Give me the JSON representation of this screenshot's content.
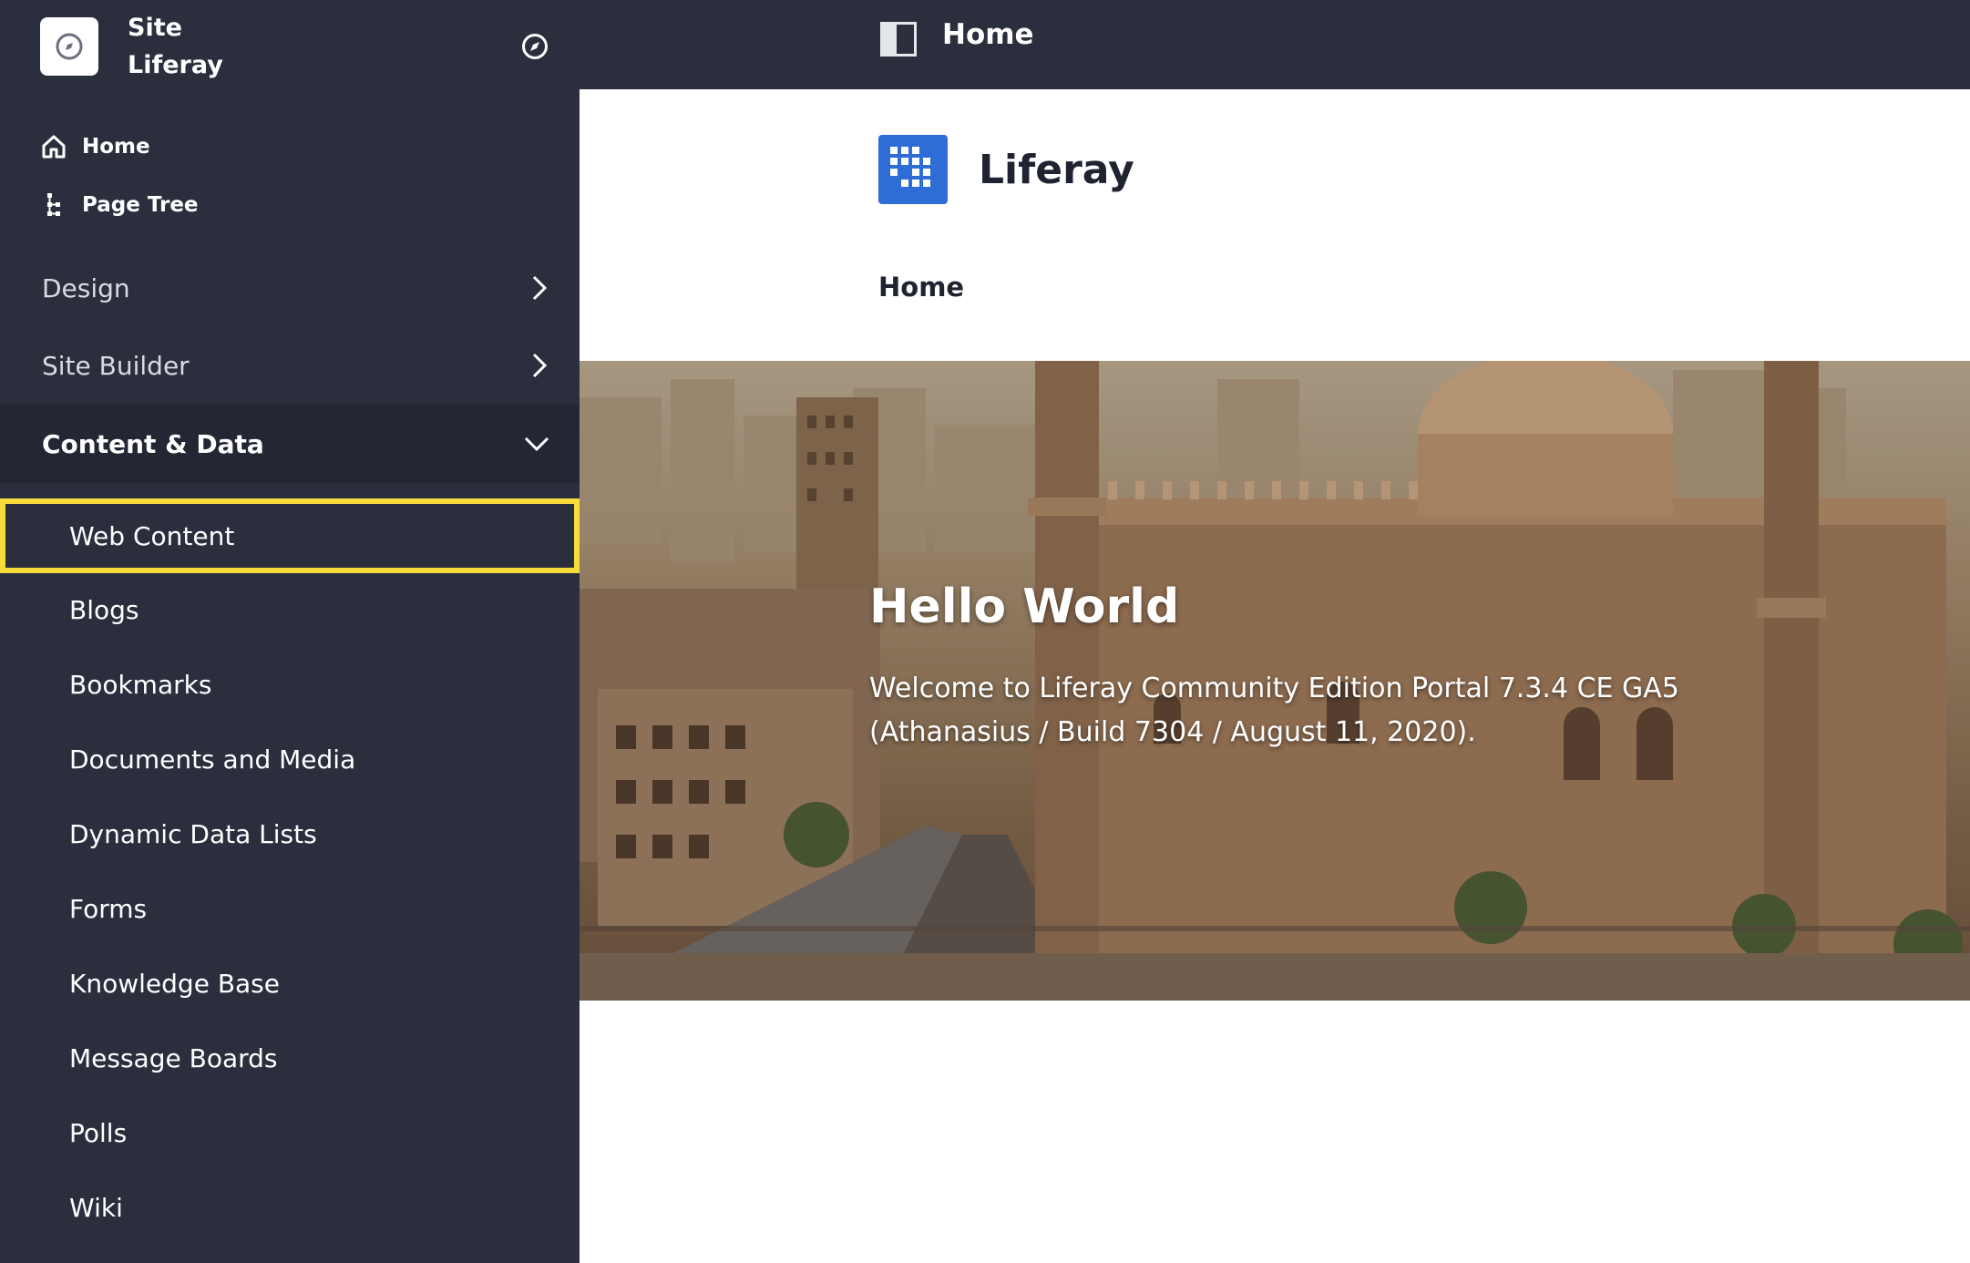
{
  "sidebar": {
    "site_label": "Site",
    "site_name": "Liferay",
    "quick": [
      {
        "label": "Home",
        "icon": "home-icon"
      },
      {
        "label": "Page Tree",
        "icon": "page-tree-icon"
      }
    ],
    "sections": [
      {
        "label": "Design",
        "state": "collapsed"
      },
      {
        "label": "Site Builder",
        "state": "collapsed"
      },
      {
        "label": "Content & Data",
        "state": "expanded"
      }
    ],
    "content_items": [
      {
        "label": "Web Content",
        "highlighted": true
      },
      {
        "label": "Blogs"
      },
      {
        "label": "Bookmarks"
      },
      {
        "label": "Documents and Media"
      },
      {
        "label": "Dynamic Data Lists"
      },
      {
        "label": "Forms"
      },
      {
        "label": "Knowledge Base"
      },
      {
        "label": "Message Boards"
      },
      {
        "label": "Polls"
      },
      {
        "label": "Wiki"
      }
    ]
  },
  "topbar": {
    "title": "Home"
  },
  "page": {
    "brand": "Liferay",
    "nav_item": "Home",
    "hero": {
      "title": "Hello World",
      "text": "Welcome to Liferay Community Edition Portal 7.3.4 CE GA5 (Athanasius / Build 7304 / August 11, 2020)."
    }
  },
  "colors": {
    "sidebar_bg": "#2b2f3d",
    "highlight": "#f7dc3b",
    "brand_blue": "#2f6dd6"
  }
}
